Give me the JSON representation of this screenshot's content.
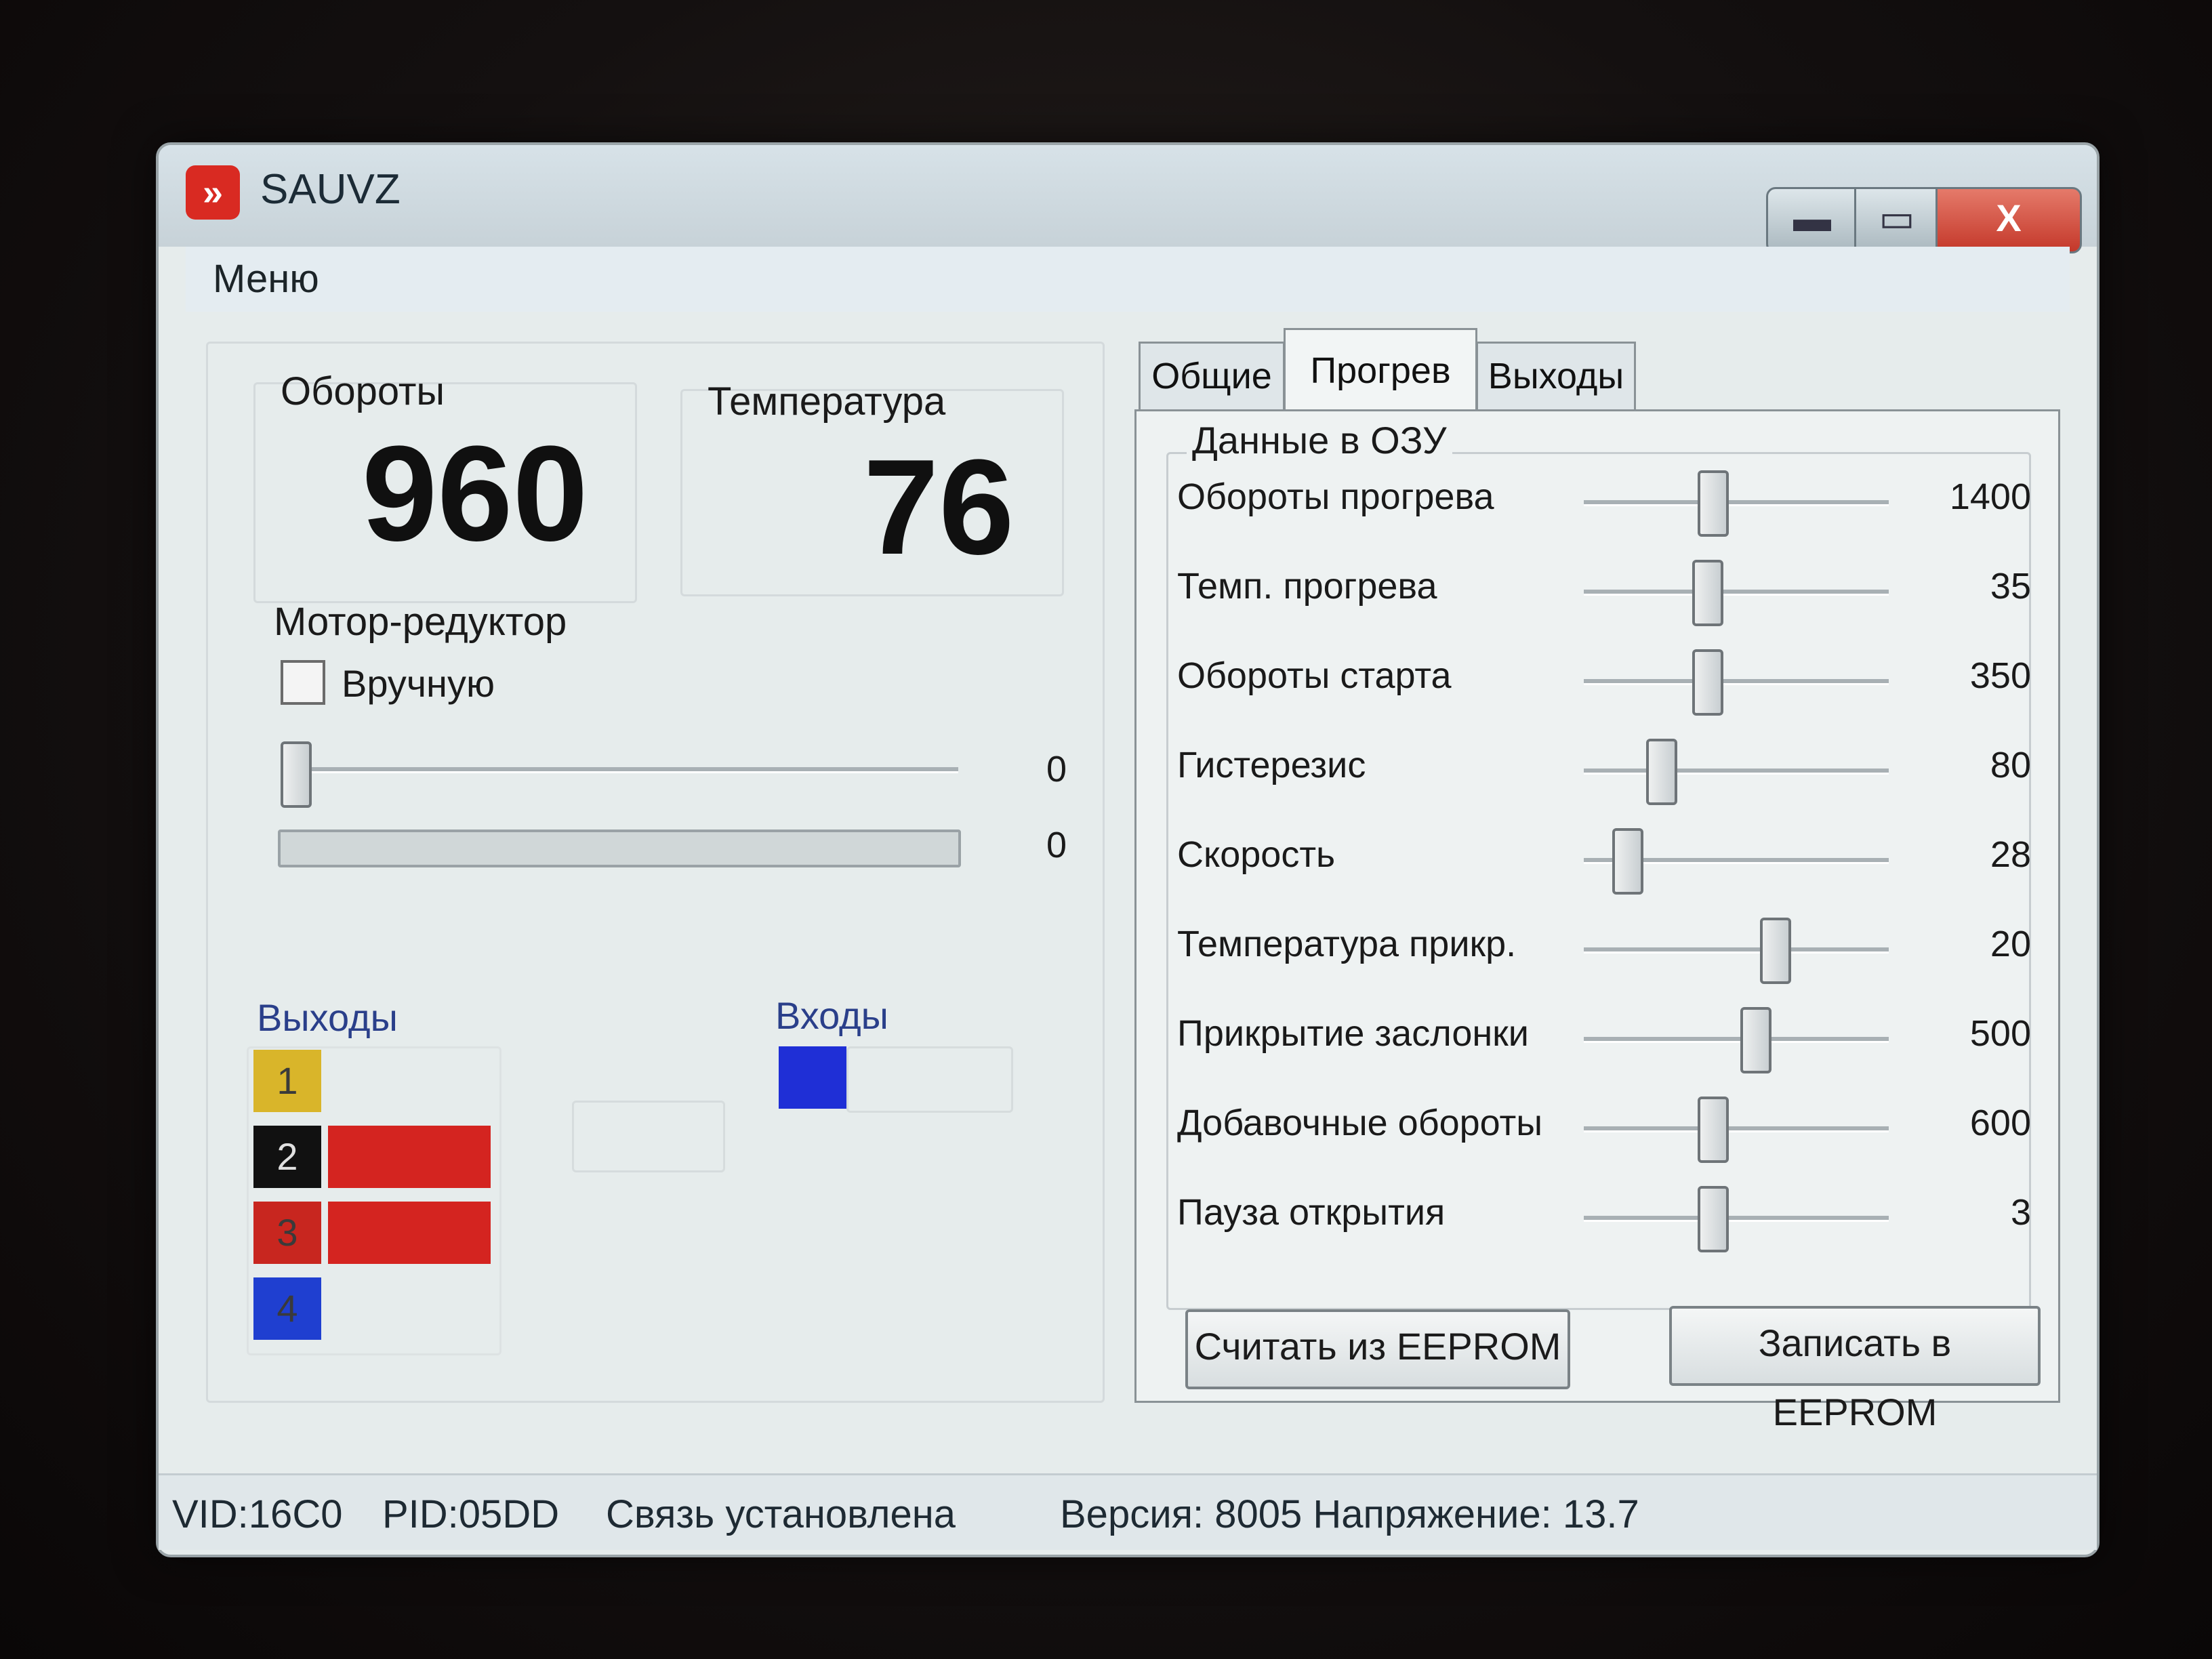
{
  "window": {
    "title": "SAUVZ",
    "buttons": {
      "minimize": "▬",
      "maximize": "▭",
      "close": "X"
    }
  },
  "menu": {
    "items": [
      "Меню"
    ]
  },
  "readings": {
    "rpm_label": "Обороты",
    "rpm_value": "960",
    "temp_label": "Температура",
    "temp_value": "76"
  },
  "motor": {
    "title": "Мотор-редуктор",
    "manual_label": "Вручную",
    "manual_checked": false,
    "slider_value": "0",
    "slider_level": 0,
    "progress_value": "0",
    "progress_level": 0
  },
  "outputs": {
    "title": "Выходы",
    "items": [
      {
        "num": "1",
        "color": "#d9b52a",
        "state_color": ""
      },
      {
        "num": "2",
        "color": "#111111",
        "state_color": "#d42420"
      },
      {
        "num": "3",
        "color": "#c8261f",
        "state_color": "#d42420"
      },
      {
        "num": "4",
        "color": "#1f3fd0",
        "state_color": ""
      }
    ]
  },
  "inputs": {
    "title": "Входы",
    "indicator_color": "#1f2fd6"
  },
  "tabs": [
    {
      "label": "Общие",
      "active": false
    },
    {
      "label": "Прогрев",
      "active": true
    },
    {
      "label": "Выходы",
      "active": false
    }
  ],
  "ram_section": {
    "title": "Данные в ОЗУ",
    "params": [
      {
        "label": "Обороты прогрева",
        "value": "1400",
        "level": 0.4
      },
      {
        "label": "Темп. прогрева",
        "value": "35",
        "level": 0.38
      },
      {
        "label": "Обороты старта",
        "value": "350",
        "level": 0.38
      },
      {
        "label": "Гистерезис",
        "value": "80",
        "level": 0.22
      },
      {
        "label": "Скорость",
        "value": "28",
        "level": 0.1
      },
      {
        "label": "Температура прикр.",
        "value": "20",
        "level": 0.62
      },
      {
        "label": "Прикрытие заслонки",
        "value": "500",
        "level": 0.55
      },
      {
        "label": "Добавочные обороты",
        "value": "600",
        "level": 0.4
      },
      {
        "label": "Пауза открытия",
        "value": "3",
        "level": 0.4
      }
    ]
  },
  "eeprom": {
    "read_label": "Считать из EEPROM",
    "write_label": "Записать в EEPROM"
  },
  "status": {
    "vid": "VID:16C0",
    "pid": "PID:05DD",
    "connection": "Связь установлена",
    "version": "Версия: 8005 Напряжение: 13.7"
  }
}
